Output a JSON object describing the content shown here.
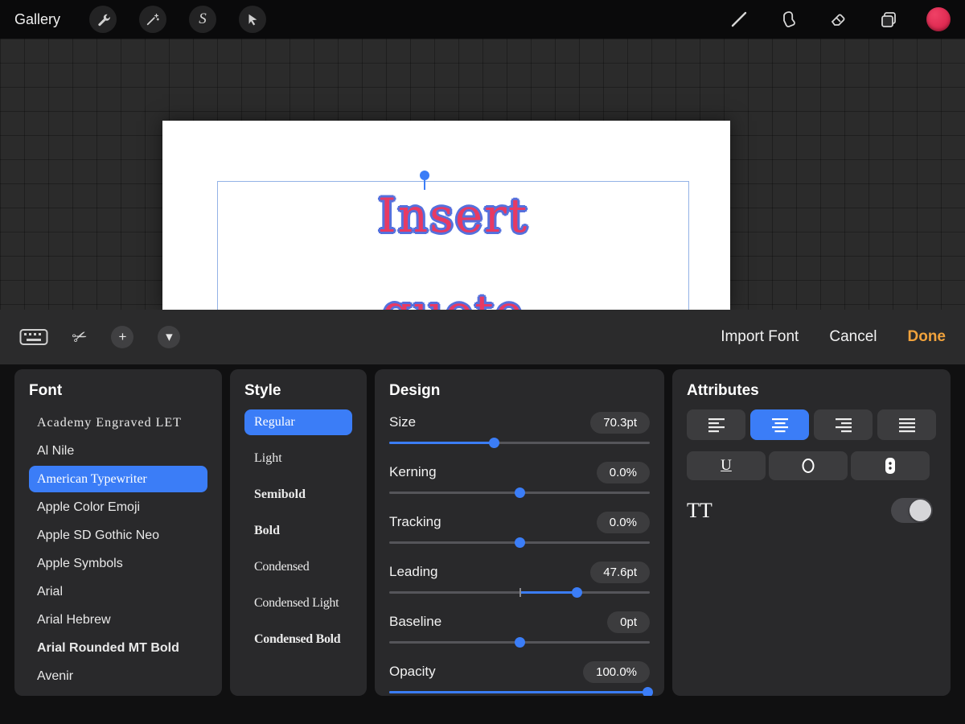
{
  "topbar": {
    "gallery_label": "Gallery",
    "left_icons": [
      "wrench-icon",
      "magic-wand-icon",
      "selection-icon",
      "transform-icon"
    ],
    "right_icons": [
      "brush-icon",
      "smudge-icon",
      "eraser-icon",
      "layers-icon",
      "color-swatch"
    ],
    "color_swatch": "#e0254d"
  },
  "canvas": {
    "text_line1": "Insert",
    "text_line2": "quote",
    "text_fill_color": "#e73a63",
    "text_outline_color": "#5570dd"
  },
  "toolbar": {
    "icons": [
      "keyboard-icon",
      "scissors-icon",
      "plus-icon",
      "chevron-down-icon"
    ],
    "import_font_label": "Import Font",
    "cancel_label": "Cancel",
    "done_label": "Done",
    "done_color": "#f0a23c"
  },
  "font_panel": {
    "title": "Font",
    "items": [
      {
        "label": "Academy Engraved LET",
        "selected": false
      },
      {
        "label": "Al Nile",
        "selected": false
      },
      {
        "label": "American Typewriter",
        "selected": true
      },
      {
        "label": "Apple Color Emoji",
        "selected": false
      },
      {
        "label": "Apple SD Gothic Neo",
        "selected": false
      },
      {
        "label": "Apple Symbols",
        "selected": false
      },
      {
        "label": "Arial",
        "selected": false
      },
      {
        "label": "Arial Hebrew",
        "selected": false
      },
      {
        "label": "Arial Rounded MT Bold",
        "selected": false
      },
      {
        "label": "Avenir",
        "selected": false
      }
    ]
  },
  "style_panel": {
    "title": "Style",
    "items": [
      {
        "label": "Regular",
        "selected": true
      },
      {
        "label": "Light",
        "selected": false
      },
      {
        "label": "Semibold",
        "selected": false
      },
      {
        "label": "Bold",
        "selected": false
      },
      {
        "label": "Condensed",
        "selected": false
      },
      {
        "label": "Condensed Light",
        "selected": false
      },
      {
        "label": "Condensed Bold",
        "selected": false
      }
    ]
  },
  "design_panel": {
    "title": "Design",
    "sliders": [
      {
        "label": "Size",
        "value": "70.3pt",
        "thumb": 40,
        "fill_start": 0,
        "fill_end": 40
      },
      {
        "label": "Kerning",
        "value": "0.0%",
        "thumb": 50,
        "fill_start": 50,
        "fill_end": 50
      },
      {
        "label": "Tracking",
        "value": "0.0%",
        "thumb": 50,
        "fill_start": 50,
        "fill_end": 50
      },
      {
        "label": "Leading",
        "value": "47.6pt",
        "thumb": 72,
        "fill_start": 50,
        "fill_end": 72,
        "tick": 50
      },
      {
        "label": "Baseline",
        "value": "0pt",
        "thumb": 50,
        "fill_start": 50,
        "fill_end": 50
      },
      {
        "label": "Opacity",
        "value": "100.0%",
        "thumb": 99,
        "fill_start": 0,
        "fill_end": 99
      }
    ]
  },
  "attributes_panel": {
    "title": "Attributes",
    "alignment_buttons": [
      "align-left",
      "align-center",
      "align-right",
      "align-justify"
    ],
    "selected_alignment": "align-center",
    "style_buttons": [
      "underline",
      "outline",
      "vertical-text"
    ],
    "underline_glyph": "U",
    "outline_glyph": "O",
    "tt_label": "TT",
    "tt_toggle_on": false,
    "accent_color": "#3b7df7"
  }
}
